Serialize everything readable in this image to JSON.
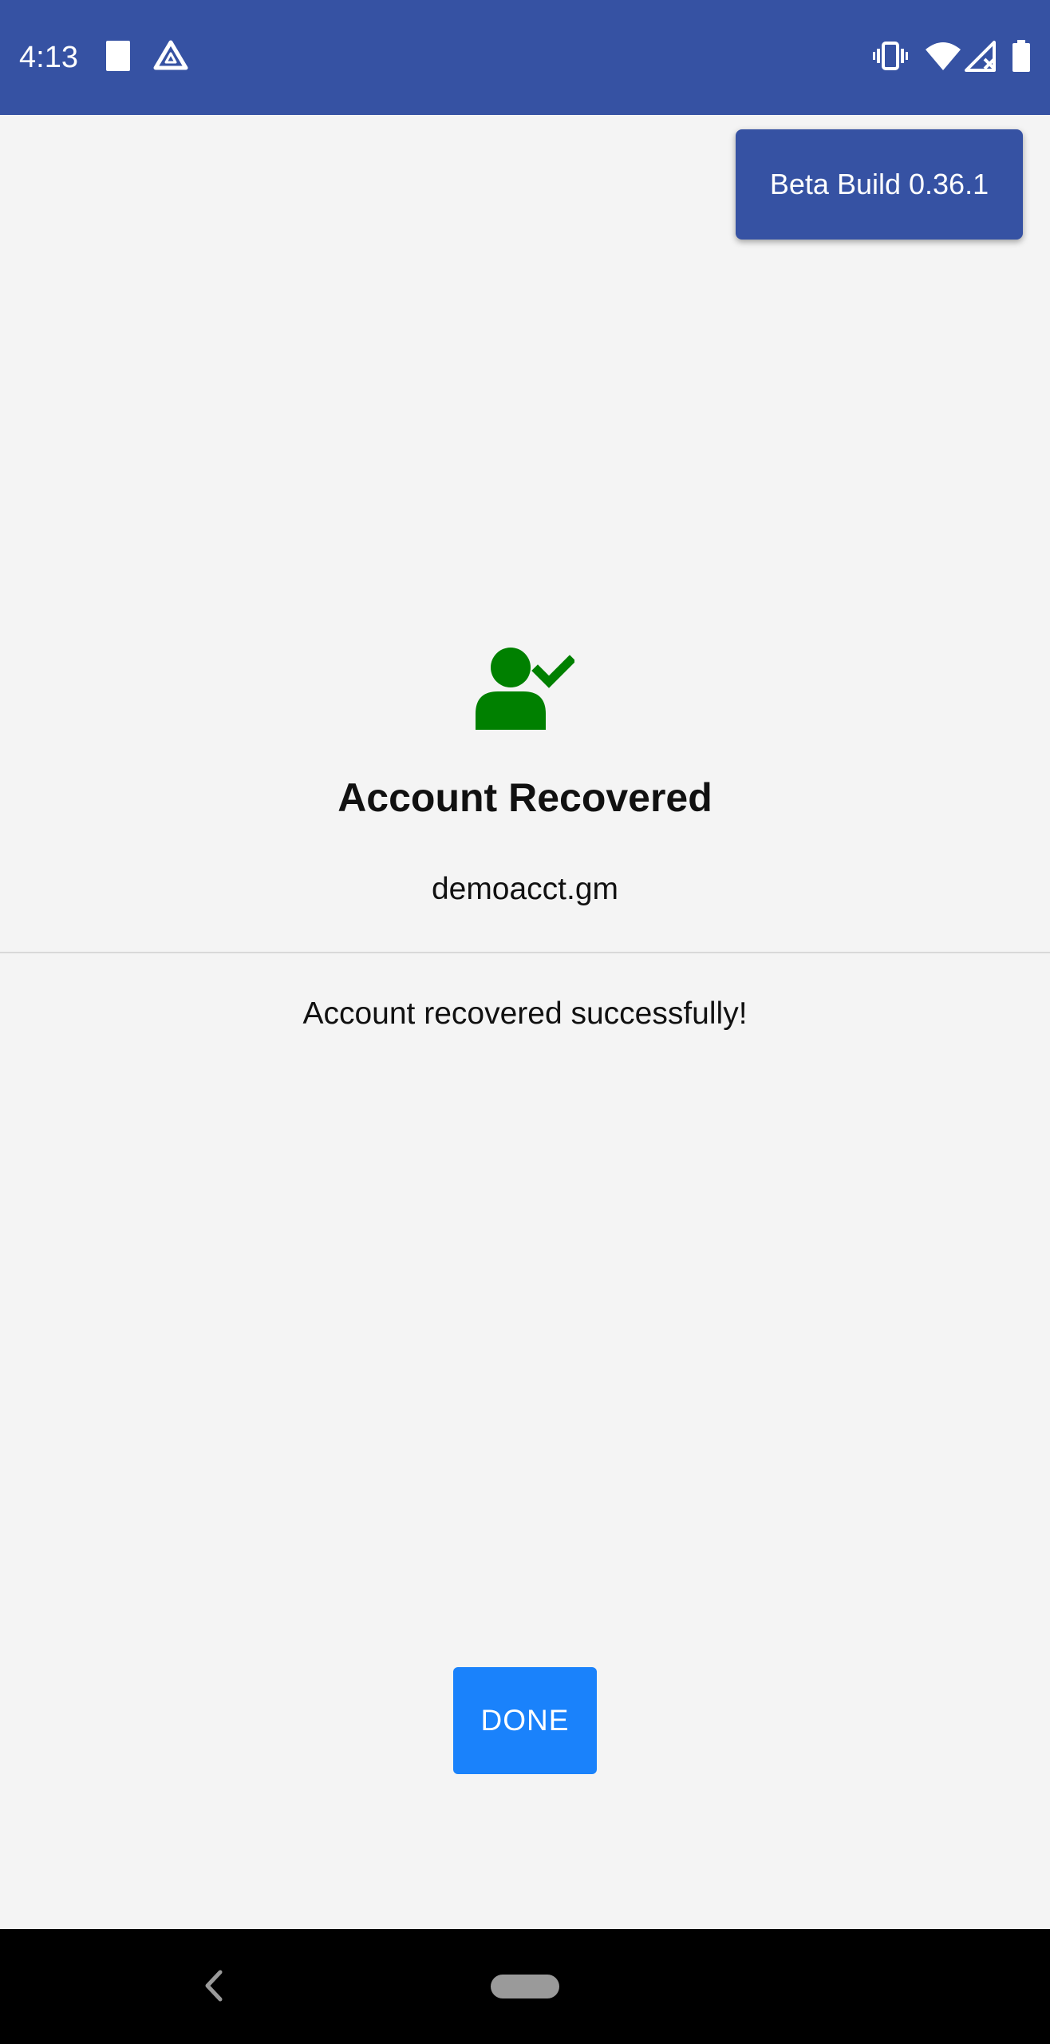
{
  "status_bar": {
    "time": "4:13",
    "left_icons": [
      "sim-card-icon",
      "drive-icon"
    ],
    "right_icons": [
      "vibrate-icon",
      "wifi-icon",
      "no-signal-icon",
      "battery-icon"
    ],
    "background_color": "#3652a3"
  },
  "badge": {
    "label": "Beta Build 0.36.1"
  },
  "main": {
    "icon": "account-check-icon",
    "icon_color": "#008000",
    "title": "Account Recovered",
    "account_name": "demoacct.gm",
    "message": "Account recovered successfully!"
  },
  "actions": {
    "done_label": "DONE",
    "done_color": "#1a82fb"
  },
  "nav_bar": {
    "buttons": [
      "back-icon",
      "home-pill"
    ]
  }
}
